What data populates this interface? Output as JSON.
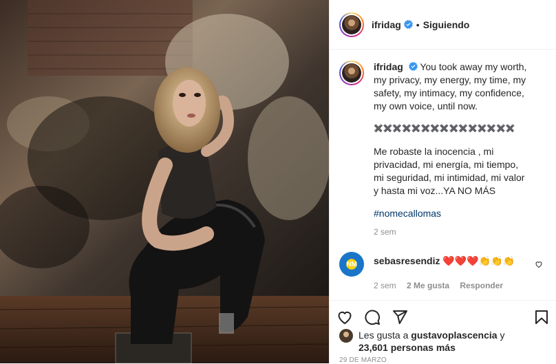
{
  "header": {
    "username": "ifridag",
    "separator": "•",
    "follow_status": "Siguiendo"
  },
  "caption": {
    "username": "ifridag",
    "line_en": "You took away my worth, my privacy, my energy, my time, my safety, my intimacy, my confidence, my own voice, until now.",
    "divider": "✖️✖️✖️✖️✖️✖️✖️✖️✖️✖️✖️✖️✖️✖️✖️",
    "line_es": "Me robaste la inocencia , mi privacidad, mi energía, mi tiempo, mi seguridad, mi intimidad, mi valor y hasta mi voz...YA NO MÁS",
    "hashtag": "#nomecallomas",
    "time": "2 sem"
  },
  "comment": {
    "username": "sebasresendiz",
    "text": "❤️❤️❤️👏👏👏",
    "avatar_text": "NM",
    "time": "2 sem",
    "likes": "2 Me gusta",
    "reply": "Responder"
  },
  "likes": {
    "prefix": "Les gusta a",
    "user": "gustavoplascencia",
    "conj": "y",
    "count": "23,601 personas más"
  },
  "date": "29 DE MARZO",
  "icons": {
    "like": "heart-icon",
    "comment": "comment-icon",
    "share": "share-icon",
    "save": "bookmark-icon",
    "verified": "verified-badge-icon"
  },
  "colors": {
    "verified": "#3897f0",
    "hashtag": "#00376b",
    "muted": "#8e8e8e"
  }
}
